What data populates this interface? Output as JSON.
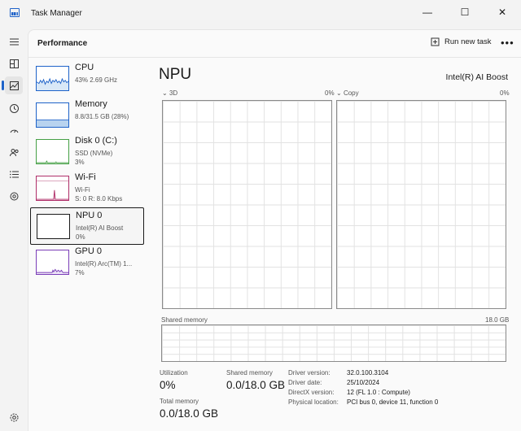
{
  "app": {
    "title": "Task Manager"
  },
  "header": {
    "title": "Performance",
    "run_task_label": "Run new task",
    "more": "•••"
  },
  "devices": [
    {
      "name": "CPU",
      "line1": "43%  2.69 GHz",
      "line2": "",
      "color": "#1f63c9",
      "fill": "#d9e8f7",
      "selected": false
    },
    {
      "name": "Memory",
      "line1": "8.8/31.5 GB (28%)",
      "line2": "",
      "color": "#1f63c9",
      "fill": "#b8d3ef",
      "selected": false
    },
    {
      "name": "Disk 0 (C:)",
      "line1": "SSD (NVMe)",
      "line2": "3%",
      "color": "#46a046",
      "fill": "#e5f2e5",
      "selected": false
    },
    {
      "name": "Wi-Fi",
      "line1": "Wi-Fi",
      "line2": "S: 0 R: 8.0 Kbps",
      "color": "#b0306a",
      "fill": "#f6e0ea",
      "selected": false
    },
    {
      "name": "NPU 0",
      "line1": "Intel(R) AI Boost",
      "line2": "0%",
      "color": "#1a1a1a",
      "fill": "#ffffff",
      "selected": true
    },
    {
      "name": "GPU 0",
      "line1": "Intel(R) Arc(TM) 1...",
      "line2": "7%",
      "color": "#7b3fb8",
      "fill": "#ece3f6",
      "selected": false
    }
  ],
  "main": {
    "title": "NPU",
    "device_model": "Intel(R) AI Boost",
    "graph1": {
      "label": "3D",
      "max": "0%"
    },
    "graph2": {
      "label": "Copy",
      "max": "0%"
    },
    "shared": {
      "label": "Shared memory",
      "max": "18.0 GB"
    }
  },
  "stats": {
    "utilization": {
      "label": "Utilization",
      "value": "0%"
    },
    "shared_memory": {
      "label": "Shared memory",
      "value": "0.0/18.0 GB"
    },
    "total_memory": {
      "label": "Total memory",
      "value": "0.0/18.0 GB"
    }
  },
  "details": [
    {
      "key": "Driver version:",
      "value": "32.0.100.3104"
    },
    {
      "key": "Driver date:",
      "value": "25/10/2024"
    },
    {
      "key": "DirectX version:",
      "value": "12 (FL 1.0 : Compute)"
    },
    {
      "key": "Physical location:",
      "value": "PCI bus 0, device 11, function 0"
    }
  ],
  "nav_icons": [
    "hamburger-icon",
    "processes-icon",
    "performance-icon",
    "app-history-icon",
    "startup-icon",
    "users-icon",
    "details-icon",
    "services-icon",
    "settings-icon"
  ],
  "window_buttons": {
    "minimize": "—",
    "maximize": "☐",
    "close": "✕"
  }
}
